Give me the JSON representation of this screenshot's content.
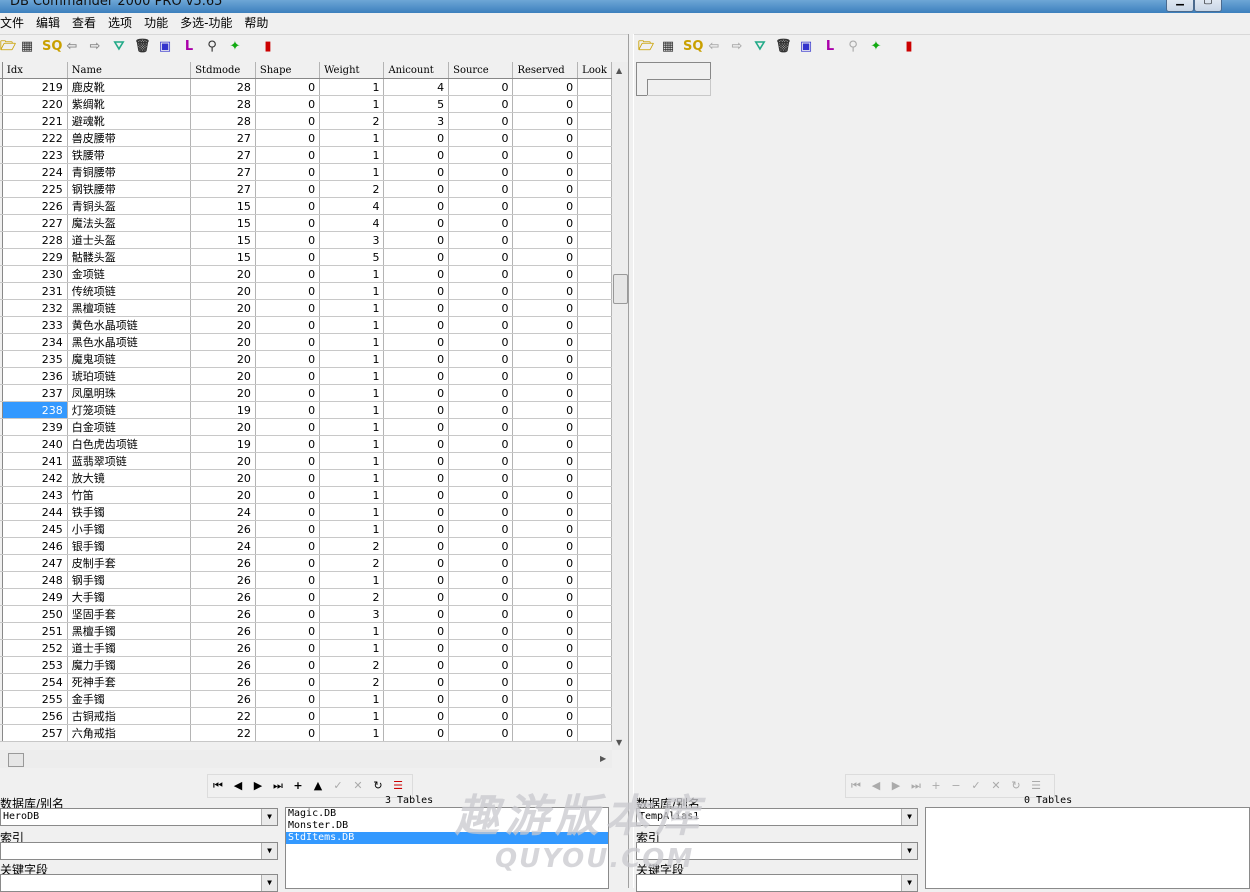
{
  "window": {
    "title": "DB Commander 2000 PRO v5.65"
  },
  "menu": [
    "文件",
    "编辑",
    "查看",
    "选项",
    "功能",
    "多选-功能",
    "帮助"
  ],
  "columns": [
    "Idx",
    "Name",
    "Stdmode",
    "Shape",
    "Weight",
    "Anicount",
    "Source",
    "Reserved",
    "Look"
  ],
  "rows": [
    [
      "219",
      "鹿皮靴",
      "28",
      "0",
      "1",
      "4",
      "0",
      "0"
    ],
    [
      "220",
      "紫绸靴",
      "28",
      "0",
      "1",
      "5",
      "0",
      "0"
    ],
    [
      "221",
      "避魂靴",
      "28",
      "0",
      "2",
      "3",
      "0",
      "0"
    ],
    [
      "222",
      "兽皮腰带",
      "27",
      "0",
      "1",
      "0",
      "0",
      "0"
    ],
    [
      "223",
      "铁腰带",
      "27",
      "0",
      "1",
      "0",
      "0",
      "0"
    ],
    [
      "224",
      "青铜腰带",
      "27",
      "0",
      "1",
      "0",
      "0",
      "0"
    ],
    [
      "225",
      "钢铁腰带",
      "27",
      "0",
      "2",
      "0",
      "0",
      "0"
    ],
    [
      "226",
      "青铜头盔",
      "15",
      "0",
      "4",
      "0",
      "0",
      "0"
    ],
    [
      "227",
      "魔法头盔",
      "15",
      "0",
      "4",
      "0",
      "0",
      "0"
    ],
    [
      "228",
      "道士头盔",
      "15",
      "0",
      "3",
      "0",
      "0",
      "0"
    ],
    [
      "229",
      "骷髅头盔",
      "15",
      "0",
      "5",
      "0",
      "0",
      "0"
    ],
    [
      "230",
      "金项链",
      "20",
      "0",
      "1",
      "0",
      "0",
      "0"
    ],
    [
      "231",
      "传统项链",
      "20",
      "0",
      "1",
      "0",
      "0",
      "0"
    ],
    [
      "232",
      "黑檀项链",
      "20",
      "0",
      "1",
      "0",
      "0",
      "0"
    ],
    [
      "233",
      "黄色水晶项链",
      "20",
      "0",
      "1",
      "0",
      "0",
      "0"
    ],
    [
      "234",
      "黑色水晶项链",
      "20",
      "0",
      "1",
      "0",
      "0",
      "0"
    ],
    [
      "235",
      "魔鬼项链",
      "20",
      "0",
      "1",
      "0",
      "0",
      "0"
    ],
    [
      "236",
      "琥珀项链",
      "20",
      "0",
      "1",
      "0",
      "0",
      "0"
    ],
    [
      "237",
      "凤凰明珠",
      "20",
      "0",
      "1",
      "0",
      "0",
      "0"
    ],
    [
      "238",
      "灯笼项链",
      "19",
      "0",
      "1",
      "0",
      "0",
      "0"
    ],
    [
      "239",
      "白金项链",
      "20",
      "0",
      "1",
      "0",
      "0",
      "0"
    ],
    [
      "240",
      "白色虎齿项链",
      "19",
      "0",
      "1",
      "0",
      "0",
      "0"
    ],
    [
      "241",
      "蓝翡翠项链",
      "20",
      "0",
      "1",
      "0",
      "0",
      "0"
    ],
    [
      "242",
      "放大镜",
      "20",
      "0",
      "1",
      "0",
      "0",
      "0"
    ],
    [
      "243",
      "竹笛",
      "20",
      "0",
      "1",
      "0",
      "0",
      "0"
    ],
    [
      "244",
      "铁手镯",
      "24",
      "0",
      "1",
      "0",
      "0",
      "0"
    ],
    [
      "245",
      "小手镯",
      "26",
      "0",
      "1",
      "0",
      "0",
      "0"
    ],
    [
      "246",
      "银手镯",
      "24",
      "0",
      "2",
      "0",
      "0",
      "0"
    ],
    [
      "247",
      "皮制手套",
      "26",
      "0",
      "2",
      "0",
      "0",
      "0"
    ],
    [
      "248",
      "钢手镯",
      "26",
      "0",
      "1",
      "0",
      "0",
      "0"
    ],
    [
      "249",
      "大手镯",
      "26",
      "0",
      "2",
      "0",
      "0",
      "0"
    ],
    [
      "250",
      "坚固手套",
      "26",
      "0",
      "3",
      "0",
      "0",
      "0"
    ],
    [
      "251",
      "黑檀手镯",
      "26",
      "0",
      "1",
      "0",
      "0",
      "0"
    ],
    [
      "252",
      "道士手镯",
      "26",
      "0",
      "1",
      "0",
      "0",
      "0"
    ],
    [
      "253",
      "魔力手镯",
      "26",
      "0",
      "2",
      "0",
      "0",
      "0"
    ],
    [
      "254",
      "死神手套",
      "26",
      "0",
      "2",
      "0",
      "0",
      "0"
    ],
    [
      "255",
      "金手镯",
      "26",
      "0",
      "1",
      "0",
      "0",
      "0"
    ],
    [
      "256",
      "古铜戒指",
      "22",
      "0",
      "1",
      "0",
      "0",
      "0"
    ],
    [
      "257",
      "六角戒指",
      "22",
      "0",
      "1",
      "0",
      "0",
      "0"
    ]
  ],
  "selected_idx": "238",
  "left_panel": {
    "db_label": "数据库/别名",
    "db_value": "HeroDB",
    "tables_count": "3 Tables",
    "tables": [
      "Magic.DB",
      "Monster.DB",
      "StdItems.DB"
    ],
    "selected_table": "StdItems.DB",
    "index_label": "索引",
    "index_value": "",
    "key_label": "关键字段",
    "key_value": ""
  },
  "right_panel": {
    "db_label": "数据库/别名",
    "db_value": "TempAlias1",
    "tables_count": "0 Tables",
    "tables": [],
    "index_label": "索引",
    "key_label": "关键字段"
  },
  "watermark": {
    "text": "趣游版本库",
    "sub": "QUYOU.COM"
  },
  "colors": {
    "selection": "#3399ff",
    "title_bar": "#3c7fbd"
  }
}
